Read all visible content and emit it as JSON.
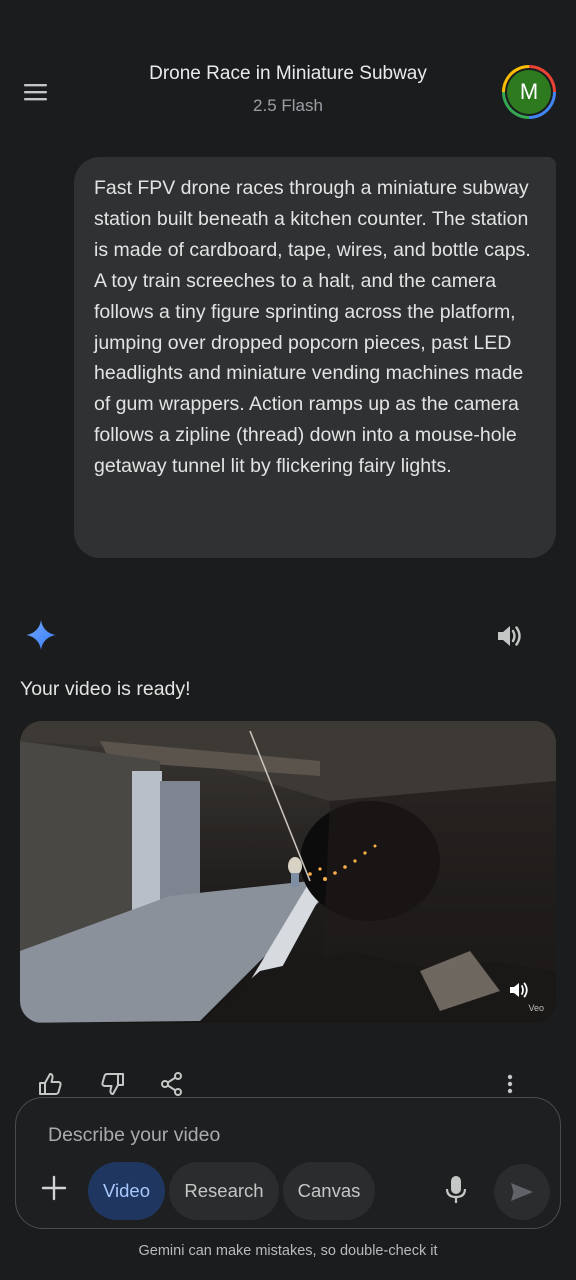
{
  "header": {
    "title": "Drone Race in Miniature Subway",
    "subtitle": "2.5 Flash",
    "avatar_initial": "M",
    "avatar_color": "#2d7a1f",
    "menu_icon": "hamburger-menu-icon"
  },
  "prompt": {
    "text": "Fast FPV drone races through a miniature subway station built beneath a kitchen counter. The station is made of cardboard, tape, wires, and bottle caps. A toy train screeches to a halt, and the camera follows a tiny figure sprinting across the platform, jumping over dropped popcorn pieces, past LED headlights and miniature vending machines made of gum wrappers. Action ramps up as the camera follows a zipline (thread) down into a mouse-hole getaway tunnel lit by flickering fairy lights."
  },
  "response": {
    "status_text": "Your video is ready!",
    "watermark": "Veo",
    "icons": [
      "gemini-spark-icon",
      "speaker-icon",
      "volume-icon"
    ]
  },
  "actions": {
    "icons": [
      "thumbs-up-icon",
      "thumbs-down-icon",
      "share-icon",
      "more-vert-icon"
    ]
  },
  "composer": {
    "placeholder": "Describe your video",
    "chips": {
      "video": "Video",
      "research": "Research",
      "canvas": "Canvas"
    },
    "active_chip_color": "#1f3760"
  },
  "footer": {
    "disclaimer": "Gemini can make mistakes, so double-check it"
  }
}
